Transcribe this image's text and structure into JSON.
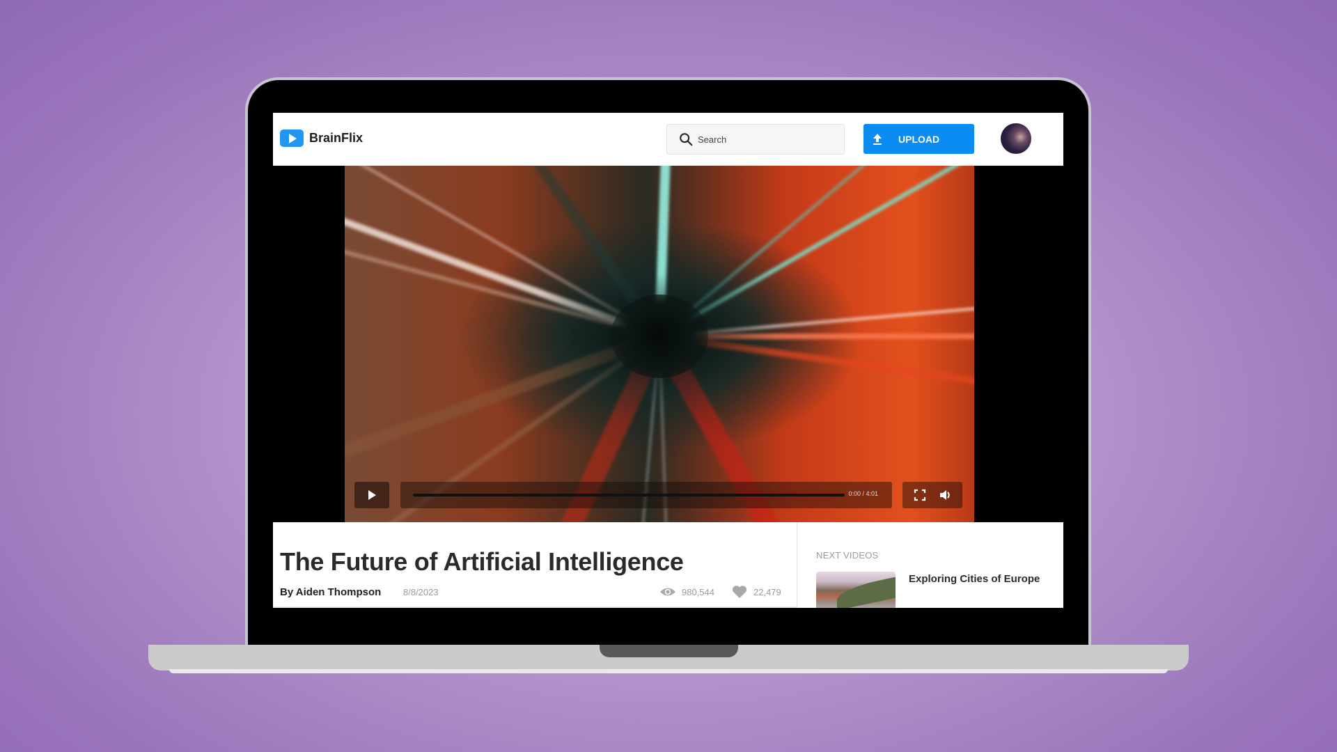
{
  "app": {
    "name": "BrainFlix",
    "brand_color": "#0b8cf3"
  },
  "header": {
    "logo_text": "BrainFlix",
    "search_placeholder": "Search",
    "search_value": "",
    "upload_label": "UPLOAD",
    "icons": {
      "logo": "play-icon",
      "search": "search-icon",
      "upload": "upload-arrow-icon",
      "avatar": "user-avatar"
    }
  },
  "player": {
    "current_time": "0:00",
    "duration": "4:01",
    "time_display": "0:00 / 4:01",
    "progress_percent": 0,
    "icons": {
      "play": "play-icon",
      "fullscreen": "fullscreen-icon",
      "volume": "volume-icon"
    }
  },
  "video": {
    "title": "The Future of Artificial Intelligence",
    "author": "By Aiden Thompson",
    "date": "8/8/2023",
    "views": "980,544",
    "likes": "22,479"
  },
  "next_videos": {
    "label": "NEXT VIDEOS",
    "items": [
      {
        "title": "Exploring Cities of Europe"
      }
    ]
  }
}
